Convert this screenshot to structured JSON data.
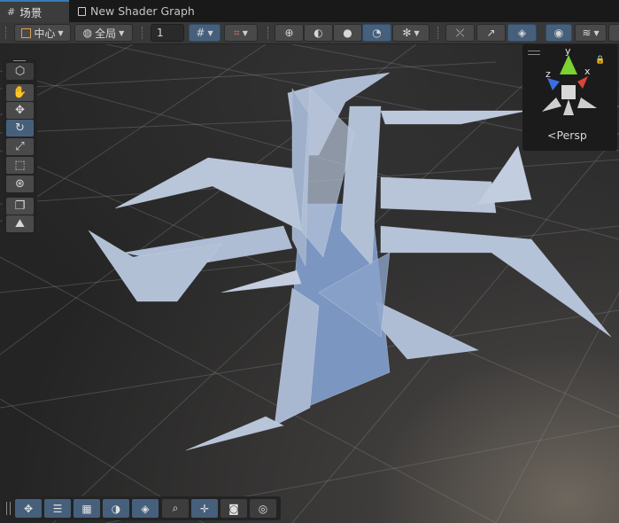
{
  "tabs": [
    {
      "label": "场景",
      "icon": "grid-icon",
      "active": true
    },
    {
      "label": "New Shader Graph",
      "icon": "shader-graph-icon",
      "active": false
    }
  ],
  "toolbar": {
    "pivot_label": "中心",
    "space_label": "全局",
    "snap_value": "1",
    "draw_mode_items": [
      "wireframe-sphere-icon",
      "shaded-wireframe-icon",
      "shaded-sphere-icon",
      "unlit-sphere-icon",
      "debug-bug-icon"
    ],
    "right_items": [
      "2d-toggle-icon",
      "lighting-toggle-icon",
      "effects-icon",
      "visibility-eye-icon",
      "layers-icon"
    ]
  },
  "left_tools": [
    "view-cube-icon",
    "hand-icon",
    "move-icon",
    "rotate-icon",
    "scale-icon",
    "rect-icon",
    "transform-icon",
    "custom-tool-icon",
    "terrain-tool-icon"
  ],
  "gizmo": {
    "axes": [
      "y",
      "z",
      "x"
    ],
    "projection_label": "Persp"
  },
  "bottom_tools": [
    "move-overlay-icon",
    "align-icon",
    "grid-snap-icon",
    "shading-icon",
    "layers-overlay-icon",
    "search-icon",
    "pivot-icon",
    "camera-icon",
    "compass-icon"
  ],
  "colors": {
    "accent": "#46607c",
    "tab_accent": "#3a79bb",
    "mesh": "#b7c6da",
    "mesh_shadow": "#6e89b3",
    "axis_x": "#d9453a",
    "axis_y": "#7bd232",
    "axis_z": "#3b6ee0"
  }
}
